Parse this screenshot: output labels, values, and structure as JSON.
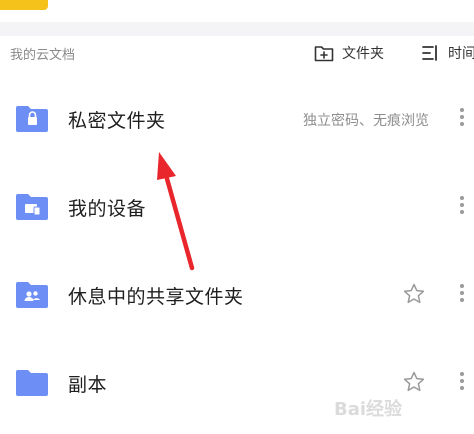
{
  "section": {
    "title": "我的云文档",
    "new_folder_label": "文件夹",
    "sort_label": "时间"
  },
  "rows": [
    {
      "name": "私密文件夹",
      "description": "独立密码、无痕浏览",
      "icon": "lock-folder-icon"
    },
    {
      "name": "我的设备",
      "icon": "device-folder-icon"
    },
    {
      "name": "休息中的共享文件夹",
      "icon": "shared-folder-icon",
      "starred": false
    },
    {
      "name": "副本",
      "icon": "folder-icon",
      "starred": false
    }
  ],
  "colors": {
    "folder_blue": "#6c8ef5",
    "accent_yellow": "#f5c21b",
    "annotation_red": "#e8262b"
  },
  "watermark": {
    "text": "Bai经验"
  }
}
